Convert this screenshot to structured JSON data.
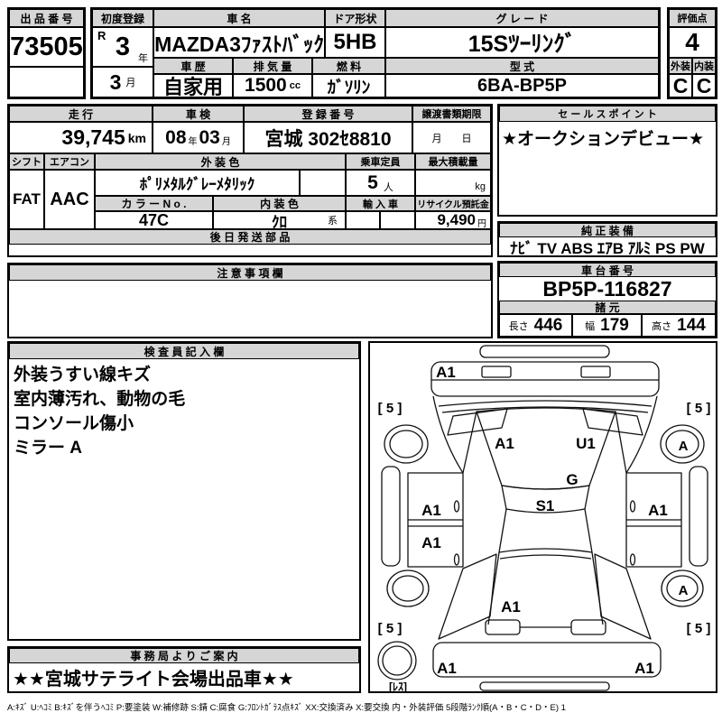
{
  "sheet": {
    "lot": {
      "label": "出 品 番 号",
      "value": "73505"
    },
    "first_reg": {
      "label": "初度登録",
      "era": "R",
      "year": "3",
      "year_unit": "年",
      "month": "3",
      "month_unit": "月"
    },
    "car_name": {
      "label": "車 名",
      "value": "MAZDA3ﾌｧｽﾄﾊﾞｯｸ"
    },
    "door": {
      "label": "ドア形状",
      "value": "5HB"
    },
    "grade": {
      "label": "グ レ ー ド",
      "value": "15Sﾂｰﾘﾝｸﾞ"
    },
    "score": {
      "label": "評価点",
      "value": "4"
    },
    "history": {
      "label": "車 歴",
      "value": "自家用"
    },
    "displacement": {
      "label": "排 気 量",
      "value": "1500",
      "unit": "cc"
    },
    "fuel": {
      "label": "燃 料",
      "value": "ｶﾞｿﾘﾝ"
    },
    "model_code": {
      "label": "型 式",
      "value": "6BA-BP5P"
    },
    "exterior_grade": {
      "label": "外装",
      "value": "C"
    },
    "interior_grade": {
      "label": "内装",
      "value": "C"
    },
    "mileage": {
      "label": "走 行",
      "value": "39,745",
      "unit": "km"
    },
    "inspection": {
      "label": "車 検",
      "year": "08",
      "year_unit": "年",
      "month": "03",
      "month_unit": "月"
    },
    "reg_number": {
      "label": "登 録 番 号",
      "value": "宮城 302ｾ8810"
    },
    "transfer_deadline": {
      "label": "譲渡書類期限",
      "value": "月　　日"
    },
    "sales_point": {
      "label": "セ ー ル ス ポ イ ン ト",
      "value": "★オークションデビュー★"
    },
    "shift": {
      "label": "シフト",
      "value": "FAT"
    },
    "aircon": {
      "label": "エアコン",
      "value": "AAC"
    },
    "ext_color": {
      "label": "外 装 色",
      "value": "ﾎﾟﾘﾒﾀﾙｸﾞﾚｰﾒﾀﾘｯｸ"
    },
    "capacity": {
      "label": "乗車定員",
      "value": "5",
      "unit": "人"
    },
    "max_load": {
      "label": "最大積載量",
      "unit": "kg"
    },
    "color_no": {
      "label": "カ ラ ー N o .",
      "value": "47C"
    },
    "int_color": {
      "label": "内 装 色",
      "value": "ｸﾛ",
      "suffix": "系"
    },
    "import_car": {
      "label": "輸 入 車"
    },
    "recycle_fee": {
      "label": "リサイクル預託金",
      "value": "9,490",
      "unit": "円"
    },
    "later_parts": {
      "label": "後 日 発 送 部 品"
    },
    "oem_equipment": {
      "label": "純 正 装 備",
      "value": "ﾅﾋﾞ TV ABS ｴｱB ｱﾙﾐ PS PW"
    },
    "notes": {
      "label": "注 意 事 項 欄"
    },
    "chassis": {
      "label": "車 台 番 号",
      "value": "BP5P-116827"
    },
    "specs": {
      "label": "諸 元",
      "length_label": "長さ",
      "length": "446",
      "width_label": "幅",
      "width": "179",
      "height_label": "高さ",
      "height": "144"
    },
    "inspector": {
      "label": "検 査 員 記 入 欄",
      "lines": [
        "外装うすい線キズ",
        "室内薄汚れ、動物の毛",
        "コンソール傷小",
        "ミラー A"
      ]
    },
    "office": {
      "label": "事 務 局 よ り ご 案 内",
      "value": "★★宮城サテライト会場出品車★★"
    }
  },
  "diagram": {
    "front_bumper": "A1",
    "tire_front_left": "[ 5 ]",
    "tire_front_right": "[ 5 ]",
    "hood_left": "A1",
    "hood_right": "U1",
    "wheel_front_right": "A",
    "windshield": "G",
    "roof": "S1",
    "door_front_left": "A1",
    "door_front_right": "A1",
    "door_rear_left": "A1",
    "hatch": "A1",
    "wheel_rear_right": "A",
    "tire_rear_left": "[ 5 ]",
    "tire_rear_right": "[ 5 ]",
    "bumper_rear_left": "A1",
    "bumper_rear_right": "A1",
    "spare": "[ﾚｽ]"
  },
  "footer": {
    "legend": "A:ｷｽﾞ U:ﾍｺﾐ B:ｷｽﾞを伴うﾍｺﾐ P:要塗装 W:補修跡 S:錆 C:腐食 G:ﾌﾛﾝﾄｶﾞﾗｽ点ｷｽﾞ XX:交換済み X:要交換  内・外装評価 5段階ﾗﾝｸ順(A・B・C・D・E) 1"
  },
  "colors": {
    "header_bg": "#d6d6d6",
    "line": "#000000",
    "paper": "#ffffff"
  }
}
